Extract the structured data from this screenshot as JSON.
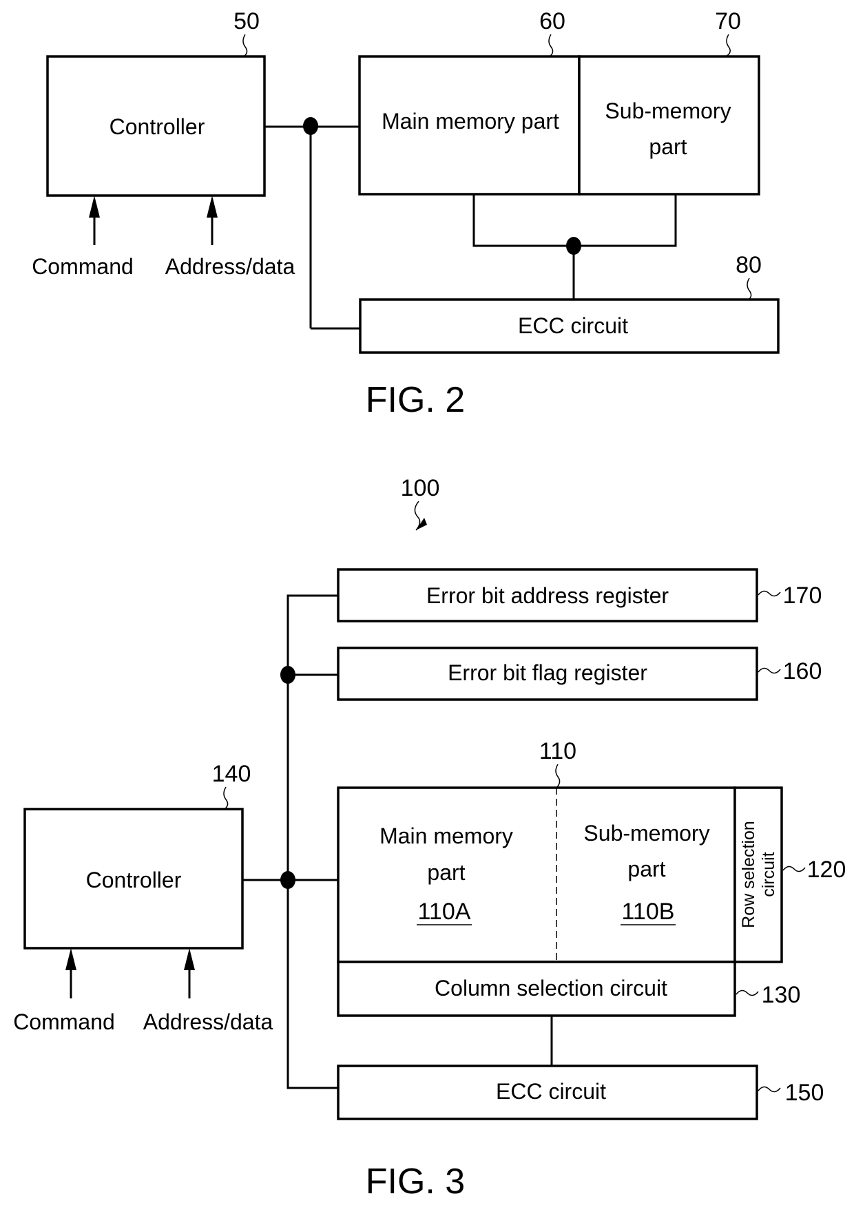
{
  "fig2": {
    "caption": "FIG. 2",
    "controller": {
      "label": "Controller",
      "ref": "50"
    },
    "main_memory": {
      "label": "Main memory part",
      "ref": "60"
    },
    "sub_memory": {
      "line1": "Sub-memory",
      "line2": "part",
      "ref": "70"
    },
    "ecc": {
      "label": "ECC circuit",
      "ref": "80"
    },
    "inputs": {
      "command": "Command",
      "address": "Address/data"
    }
  },
  "fig3": {
    "caption": "FIG. 3",
    "device_ref": "100",
    "error_addr_reg": {
      "label": "Error bit address register",
      "ref": "170"
    },
    "error_flag_reg": {
      "label": "Error bit flag register",
      "ref": "160"
    },
    "memory_array_ref": "110",
    "main_memory": {
      "line1": "Main memory",
      "line2": "part",
      "id": "110A"
    },
    "sub_memory": {
      "line1": "Sub-memory",
      "line2": "part",
      "id": "110B"
    },
    "row_select": {
      "line1": "Row selection",
      "line2": "circuit",
      "ref": "120"
    },
    "col_select": {
      "label": "Column selection circuit",
      "ref": "130"
    },
    "controller": {
      "label": "Controller",
      "ref": "140"
    },
    "ecc": {
      "label": "ECC circuit",
      "ref": "150"
    },
    "inputs": {
      "command": "Command",
      "address": "Address/data"
    }
  }
}
